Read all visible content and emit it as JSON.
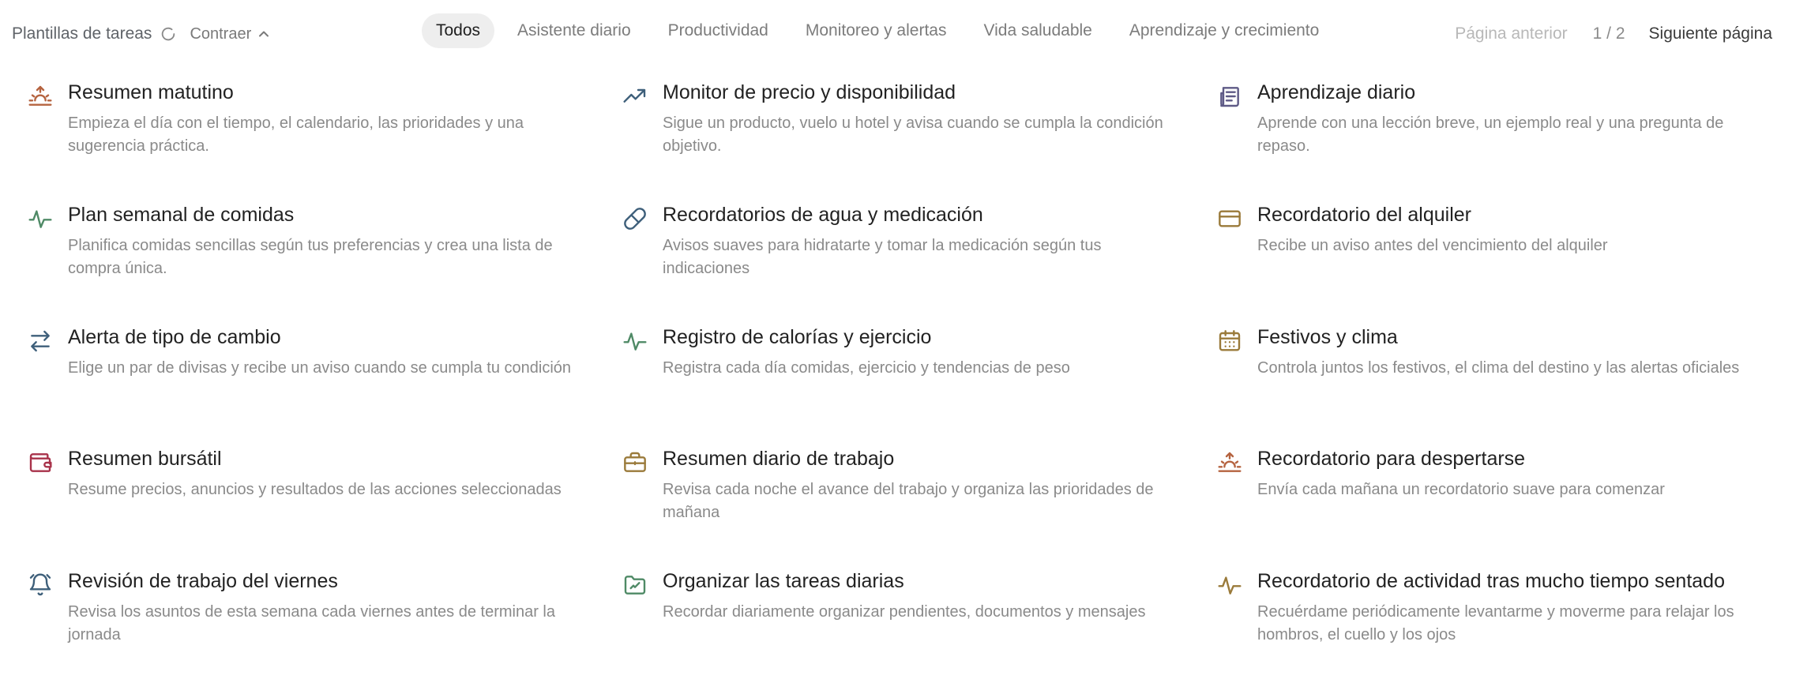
{
  "header": {
    "title": "Plantillas de tareas",
    "collapse_label": "Contraer",
    "tabs": [
      {
        "label": "Todos",
        "active": true
      },
      {
        "label": "Asistente diario",
        "active": false
      },
      {
        "label": "Productividad",
        "active": false
      },
      {
        "label": "Monitoreo y alertas",
        "active": false
      },
      {
        "label": "Vida saludable",
        "active": false
      },
      {
        "label": "Aprendizaje y crecimiento",
        "active": false
      }
    ],
    "pager": {
      "prev_label": "Página anterior",
      "count": "1 / 2",
      "next_label": "Siguiente página"
    }
  },
  "templates": [
    {
      "title": "Resumen matutino",
      "description": "Empieza el día con el tiempo, el calendario, las prioridades y una sugerencia práctica.",
      "icon": "sunrise-icon",
      "color": "#b5633f"
    },
    {
      "title": "Monitor de precio y disponibilidad",
      "description": "Sigue un producto, vuelo u hotel y avisa cuando se cumpla la condición objetivo.",
      "icon": "trending-up-icon",
      "color": "#3e5f7a"
    },
    {
      "title": "Aprendizaje diario",
      "description": "Aprende con una lección breve, un ejemplo real y una pregunta de repaso.",
      "icon": "newspaper-icon",
      "color": "#5e5a86"
    },
    {
      "title": "Plan semanal de comidas",
      "description": "Planifica comidas sencillas según tus preferencias y crea una lista de compra única.",
      "icon": "activity-icon",
      "color": "#4f8a66"
    },
    {
      "title": "Recordatorios de agua y medicación",
      "description": "Avisos suaves para hidratarte y tomar la medicación según tus indicaciones",
      "icon": "pill-icon",
      "color": "#3e5f7a"
    },
    {
      "title": "Recordatorio del alquiler",
      "description": "Recibe un aviso antes del vencimiento del alquiler",
      "icon": "credit-card-icon",
      "color": "#9a7a3a"
    },
    {
      "title": "Alerta de tipo de cambio",
      "description": "Elige un par de divisas y recibe un aviso cuando se cumpla tu condición",
      "icon": "arrows-exchange-icon",
      "color": "#3e5f7a"
    },
    {
      "title": "Registro de calorías y ejercicio",
      "description": "Registra cada día comidas, ejercicio y tendencias de peso",
      "icon": "activity-icon",
      "color": "#4f8a66"
    },
    {
      "title": "Festivos y clima",
      "description": "Controla juntos los festivos, el clima del destino y las alertas oficiales",
      "icon": "calendar-icon",
      "color": "#9a7a3a"
    },
    {
      "title": "Resumen bursátil",
      "description": "Resume precios, anuncios y resultados de las acciones seleccionadas",
      "icon": "wallet-icon",
      "color": "#a8324a"
    },
    {
      "title": "Resumen diario de trabajo",
      "description": "Revisa cada noche el avance del trabajo y organiza las prioridades de mañana",
      "icon": "briefcase-icon",
      "color": "#9a7a3a"
    },
    {
      "title": "Recordatorio para despertarse",
      "description": "Envía cada mañana un recordatorio suave para comenzar",
      "icon": "sunrise-icon",
      "color": "#b5633f"
    },
    {
      "title": "Revisión de trabajo del viernes",
      "description": "Revisa los asuntos de esta semana cada viernes antes de terminar la jornada",
      "icon": "alarm-clock-icon",
      "color": "#3e5f7a"
    },
    {
      "title": "Organizar las tareas diarias",
      "description": "Recordar diariamente organizar pendientes, documentos y mensajes",
      "icon": "folder-icon",
      "color": "#4f8a66"
    },
    {
      "title": "Recordatorio de actividad tras mucho tiempo sentado",
      "description": "Recuérdame periódicamente levantarme y moverme para relajar los hombros, el cuello y los ojos",
      "icon": "activity-icon",
      "color": "#9a7a3a"
    }
  ]
}
